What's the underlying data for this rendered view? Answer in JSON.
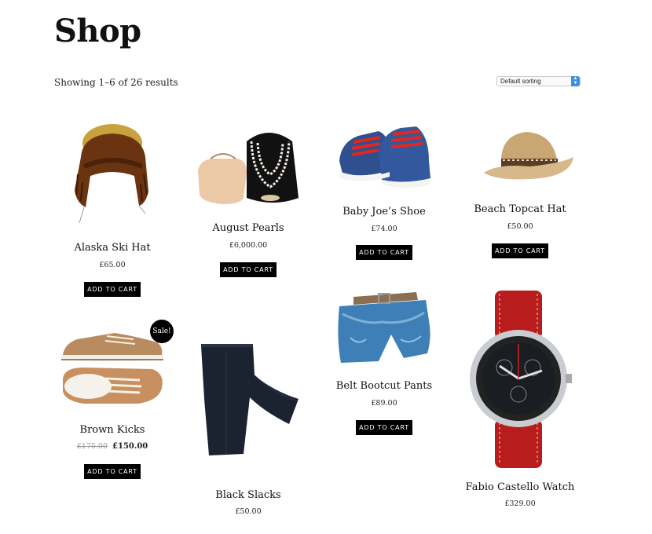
{
  "page": {
    "title": "Shop",
    "result_count": "Showing 1–6 of 26 results"
  },
  "sorting": {
    "selected": "Default sorting",
    "arrow_icon": "select-arrows-icon"
  },
  "colors": {
    "button_bg": "#000000",
    "button_text": "#ffffff",
    "sale_badge": "#000000",
    "select_arrow": "#3f8ee8"
  },
  "products": [
    {
      "name": "Alaska Ski Hat",
      "price": "£65.00",
      "button": "ADD TO CART",
      "image": "fur-trapper-hat"
    },
    {
      "name": "August Pearls",
      "price": "£6,000.00",
      "button": "ADD TO CART",
      "image": "pearl-necklace-and-clutch"
    },
    {
      "name": "Baby Joe’s Shoe",
      "price": "£74.00",
      "button": "ADD TO CART",
      "image": "baby-sneakers"
    },
    {
      "name": "Beach Topcat Hat",
      "price": "£50.00",
      "button": "ADD TO CART",
      "image": "straw-fedora"
    },
    {
      "name": "Brown Kicks",
      "old_price": "£175.00",
      "price": "£150.00",
      "button": "ADD TO CART",
      "badge": "Sale!",
      "image": "brown-sneakers"
    },
    {
      "name": "Black Slacks",
      "price": "£50.00",
      "image": "black-trousers"
    },
    {
      "name": "Belt Bootcut Pants",
      "price": "£89.00",
      "button": "ADD TO CART",
      "image": "denim-shorts-with-belt"
    },
    {
      "name": "Fabio Castello Watch",
      "price": "£329.00",
      "image": "red-strap-chronograph-watch"
    }
  ]
}
